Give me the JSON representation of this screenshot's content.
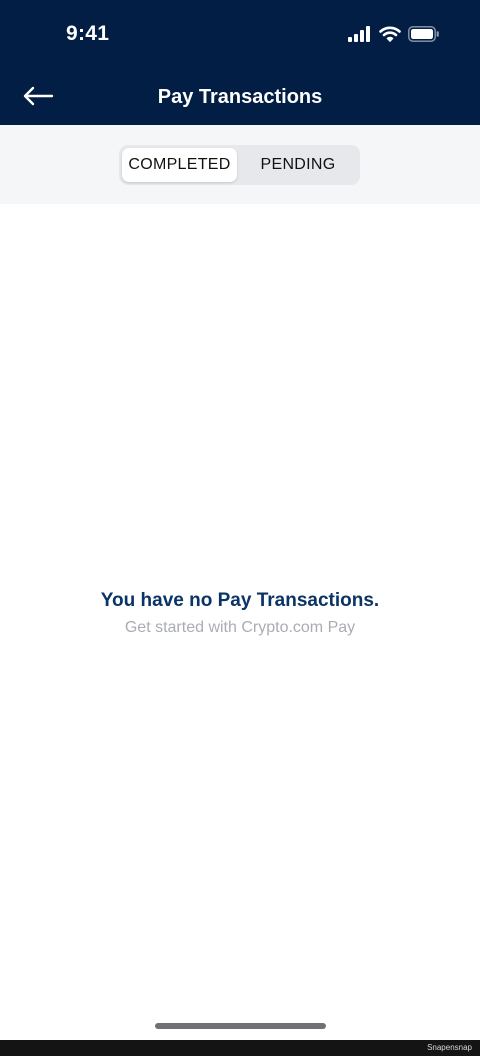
{
  "status_bar": {
    "time": "9:41",
    "icons": [
      "cellular-signal-icon",
      "wifi-icon",
      "battery-icon"
    ]
  },
  "header": {
    "title": "Pay Transactions",
    "back_icon": "arrow-left-icon"
  },
  "tabs": [
    {
      "label": "COMPLETED",
      "selected": true
    },
    {
      "label": "PENDING",
      "selected": false
    }
  ],
  "empty_state": {
    "title": "You have no Pay Transactions.",
    "subtitle": "Get started with Crypto.com Pay"
  },
  "watermark": "Snapensnap",
  "colors": {
    "header_background": "#031e44",
    "tab_band_background": "#f4f6f8",
    "empty_title": "#0b3466",
    "empty_subtitle": "#a9adb3"
  }
}
